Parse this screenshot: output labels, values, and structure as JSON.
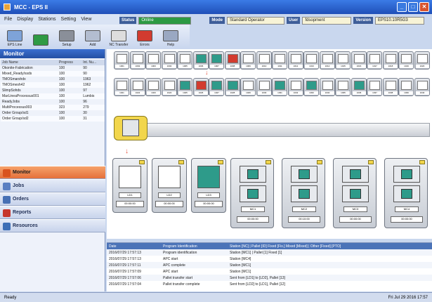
{
  "window": {
    "title": "MCC - EPS II"
  },
  "menu": [
    "File",
    "Display",
    "Stations",
    "Setting",
    "View"
  ],
  "top_status": {
    "status_label": "Status",
    "status_value": "Online",
    "mode_label": "Mode",
    "mode_value": "Standard Operator",
    "user_label": "User",
    "user_value": "fdsopment",
    "version_label": "Version",
    "version_value": "EPS10.10R5G3"
  },
  "toolbar": [
    {
      "label": "EPS Line",
      "color": "#7ea3d8"
    },
    {
      "label": "",
      "color": "#2f9a44"
    },
    {
      "label": "Setup",
      "color": "#8a8f99"
    },
    {
      "label": "Add",
      "color": "#b3bdd0"
    },
    {
      "label": "NC Transfer",
      "color": "#ddd"
    },
    {
      "label": "Errors",
      "color": "#d23b2f"
    },
    {
      "label": "Help",
      "color": "#9aa8c2"
    }
  ],
  "sidebar": {
    "title": "Monitor",
    "columns": [
      "Job Name",
      "Progress",
      "Int. Nu..."
    ],
    "rows": [
      [
        "Okonite-Fabrication",
        "100",
        "90"
      ],
      [
        "Mixed_Ready/ssds",
        "100",
        "90"
      ],
      [
        "TMOSmarshdx",
        "100",
        "1963"
      ],
      [
        "TMOSmesh42",
        "100",
        "1962"
      ],
      [
        "SlimpSohds",
        "100",
        "97"
      ],
      [
        "MarLineaProcessus001",
        "100",
        "Lumbis"
      ],
      [
        "ReadyJobs",
        "100",
        "96"
      ],
      [
        "MultiProcessus003",
        "323",
        "279"
      ],
      [
        "Order Group/sd1",
        "100",
        "30"
      ],
      [
        "Order Group/sd2",
        "100",
        "31"
      ]
    ]
  },
  "nav": [
    {
      "label": "Monitor",
      "color": "#d9531e"
    },
    {
      "label": "Jobs",
      "color": "#5a7fc2"
    },
    {
      "label": "Orders",
      "color": "#4670b4"
    },
    {
      "label": "Reports",
      "color": "#c6372c"
    },
    {
      "label": "Resources",
      "color": "#3d6fb6"
    }
  ],
  "magazine": {
    "row1": [
      "1001",
      "1002",
      "1003",
      "1004",
      "1005",
      "1006",
      "1007",
      "1008",
      "1009",
      "1010",
      "1011",
      "1012",
      "1013",
      "1014",
      "1015",
      "1016",
      "1017",
      "1018",
      "1019",
      "1020"
    ],
    "row2": [
      "1021",
      "1022",
      "1023",
      "1024",
      "1025",
      "1026",
      "1027",
      "1028",
      "1029",
      "1030",
      "1031",
      "1032",
      "1033",
      "1034",
      "1035",
      "1036",
      "1037",
      "1038",
      "1039",
      "1040"
    ]
  },
  "stations_small": [
    {
      "name": "LD1",
      "time": "00:00:00"
    },
    {
      "name": "LD2",
      "time": "00:00:00"
    },
    {
      "name": "LD3",
      "time": "00:00:00"
    }
  ],
  "stations_big": [
    {
      "name": "MC1",
      "time": "00:00:00"
    },
    {
      "name": "MC2",
      "time": "00:10:00"
    },
    {
      "name": "MC3",
      "time": "00:00:00"
    },
    {
      "name": "MC4",
      "time": "00:00:00"
    }
  ],
  "log": {
    "columns": [
      "Date",
      "Program Identification",
      "Station [NC] | Pallet [ID] Fixed [Fix.] Mixed [Mixed] | Other [Fixed] [PTO]"
    ],
    "rows": [
      [
        "2016/07/29 17:57:13",
        "Program identification",
        "Station [MC1] | Pallet [1] Fixed [1]"
      ],
      [
        "2016/07/29 17:57:13",
        "APC start",
        "Station [MC4]"
      ],
      [
        "2016/07/29 17:57:11",
        "APC complete",
        "Station [MC1]"
      ],
      [
        "2016/07/29 17:57:09",
        "APC start",
        "Station [MC1]"
      ],
      [
        "2016/07/29 17:57:06",
        "Pallet transfer start",
        "Sent from [LD1] to [LD2], Pallet [13]"
      ],
      [
        "2016/07/29 17:57:04",
        "Pallet transfer complete",
        "Sent from [LD2] to [LD1], Pallet [12]"
      ]
    ]
  },
  "bottom": {
    "left": "Ready",
    "right": "Fri Jul 29 2016 17:57"
  },
  "colors": {
    "accent": "#e5703a",
    "title": "#1f4fb8",
    "online": "#2d9a43"
  }
}
